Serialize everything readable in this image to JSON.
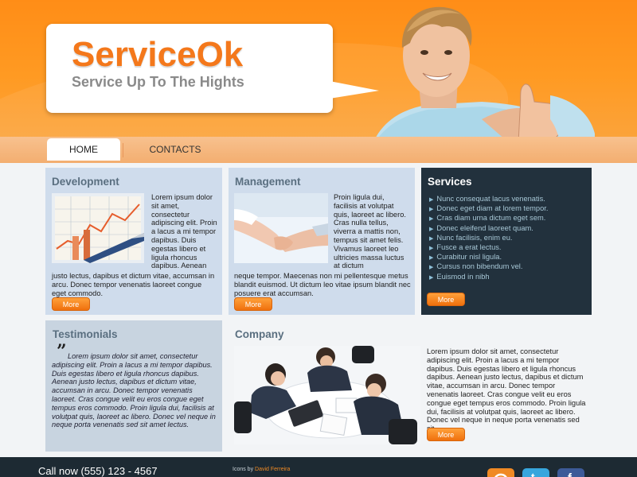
{
  "brand": {
    "name": "ServiceOk",
    "tagline": "Service Up To The Hights"
  },
  "nav": {
    "items": [
      {
        "label": "HOME",
        "active": true
      },
      {
        "label": "CONTACTS",
        "active": false
      }
    ]
  },
  "development": {
    "title": "Development",
    "text_side": "Lorem ipsum dolor sit amet, consectetur adipiscing elit. Proin a lacus a mi tempor dapibus. Duis egestas libero et ligula rhoncus dapibus. Aenean",
    "text_full": "justo lectus, dapibus et dictum vitae, accumsan in arcu. Donec tempor venenatis laoreet congue eget commodo.",
    "more_label": "More"
  },
  "management": {
    "title": "Management",
    "text_side": "Proin ligula dui, facilisis at volutpat quis, laoreet ac libero. Cras nulla tellus, viverra a mattis non, tempus sit amet felis. Vivamus laoreet leo ultricies massa luctus at dictum",
    "text_full": "neque tempor. Maecenas non mi pellentesque metus blandit euismod. Ut dictum leo vitae ipsum blandit nec posuere erat accumsan.",
    "more_label": "More"
  },
  "services": {
    "title": "Services",
    "items": [
      "Nunc consequat lacus venenatis.",
      "Donec eget diam at lorem tempor.",
      "Cras diam urna dictum eget sem.",
      "Donec eleifend laoreet quam.",
      "Nunc facilisis, enim eu.",
      "Fusce a erat lectus.",
      "Curabitur nisl ligula.",
      "Cursus non bibendum vel.",
      "Euismod in nibh"
    ],
    "more_label": "More"
  },
  "testimonials": {
    "title": "Testimonials",
    "quote_mark": "”",
    "text": "Lorem ipsum dolor sit amet, consectetur adipiscing elit. Proin a lacus a mi tempor dapibus. Duis egestas libero et ligula rhoncus dapibus. Aenean justo lectus, dapibus et dictum vitae, accumsan in arcu. Donec tempor venenatis laoreet. Cras congue velit eu eros congue eget tempus eros commodo. Proin ligula dui, facilisis at volutpat quis, laoreet ac libero. Donec vel neque in neque porta venenatis sed sit amet lectus."
  },
  "company": {
    "title": "Company",
    "text": "Lorem ipsum dolor sit amet, consectetur adipiscing elit. Proin a lacus a mi tempor dapibus. Duis egestas libero et ligula rhoncus dapibus. Aenean justo lectus, dapibus et dictum vitae, accumsan in arcu. Donec tempor venenatis laoreet. Cras congue velit eu eros congue eget tempus eros commodo. Proin ligula dui, facilisis at volutpat quis, laoreet ac libero. Donec vel neque in neque porta venenatis sed sit.",
    "more_label": "More"
  },
  "footer": {
    "phone": "Call now (555) 123 - 4567",
    "icons_by": "Icons by ",
    "icons_author": "David Ferreira",
    "social": [
      "rss-icon",
      "twitter-icon",
      "facebook-icon"
    ]
  },
  "colors": {
    "brand_orange": "#f4781b",
    "header_orange": "#ff8d17",
    "panel_blue": "#cfdcec",
    "panel_dark": "#22313d",
    "footer_dark": "#1d2a33"
  }
}
